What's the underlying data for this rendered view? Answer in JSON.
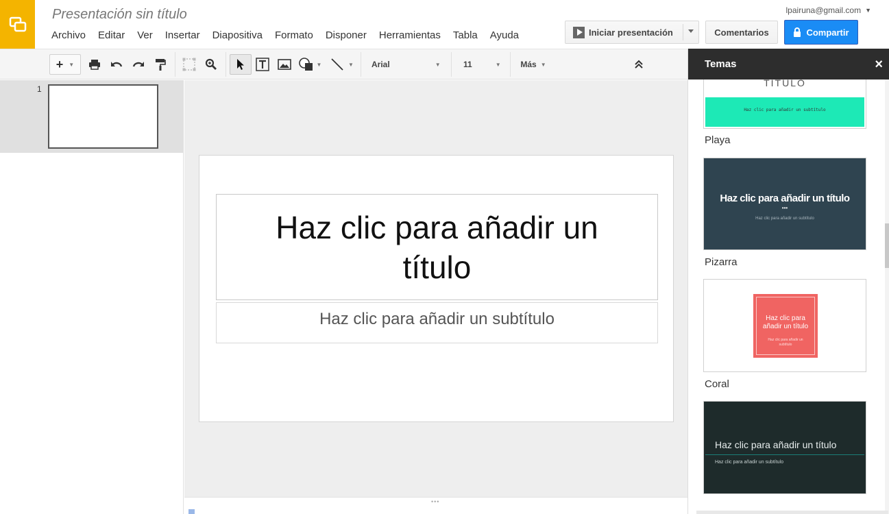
{
  "app": {
    "doc_title": "Presentación sin título",
    "account": "lpairuna@gmail.com",
    "menu": [
      "Archivo",
      "Editar",
      "Ver",
      "Insertar",
      "Diapositiva",
      "Formato",
      "Disponer",
      "Herramientas",
      "Tabla",
      "Ayuda"
    ]
  },
  "actions": {
    "present_label": "Iniciar presentación",
    "comments_label": "Comentarios",
    "share_label": "Compartir"
  },
  "toolbar": {
    "font": "Arial",
    "font_size": "11",
    "more_label": "Más"
  },
  "filmstrip": {
    "slide_number": "1"
  },
  "slide": {
    "title_placeholder": "Haz clic para añadir un título",
    "subtitle_placeholder": "Haz clic para añadir un subtítulo"
  },
  "themes": {
    "header": "Temas",
    "close_symbol": "×",
    "items": [
      {
        "name": "Playa",
        "preview_title": "TÍTULO",
        "preview_subtitle": "Haz clic para añadir un subtítulo",
        "color": "#1de9b6"
      },
      {
        "name": "Pizarra",
        "preview_title": "Haz clic para añadir un título",
        "preview_subtitle": "Haz clic para añadir un subtítulo",
        "color": "#2f4450"
      },
      {
        "name": "Coral",
        "preview_title": "Haz clic para añadir un título",
        "preview_subtitle": "Haz clic para añadir un subtítulo",
        "color": "#f06462"
      },
      {
        "preview_title": "Haz clic para añadir un título",
        "preview_subtitle": "Haz clic para añadir un subtítulo",
        "color": "#1e2b2b"
      }
    ]
  },
  "colors": {
    "logo": "#f4b400",
    "share": "#1a8cf5",
    "panel_header": "#2d2d2d"
  }
}
